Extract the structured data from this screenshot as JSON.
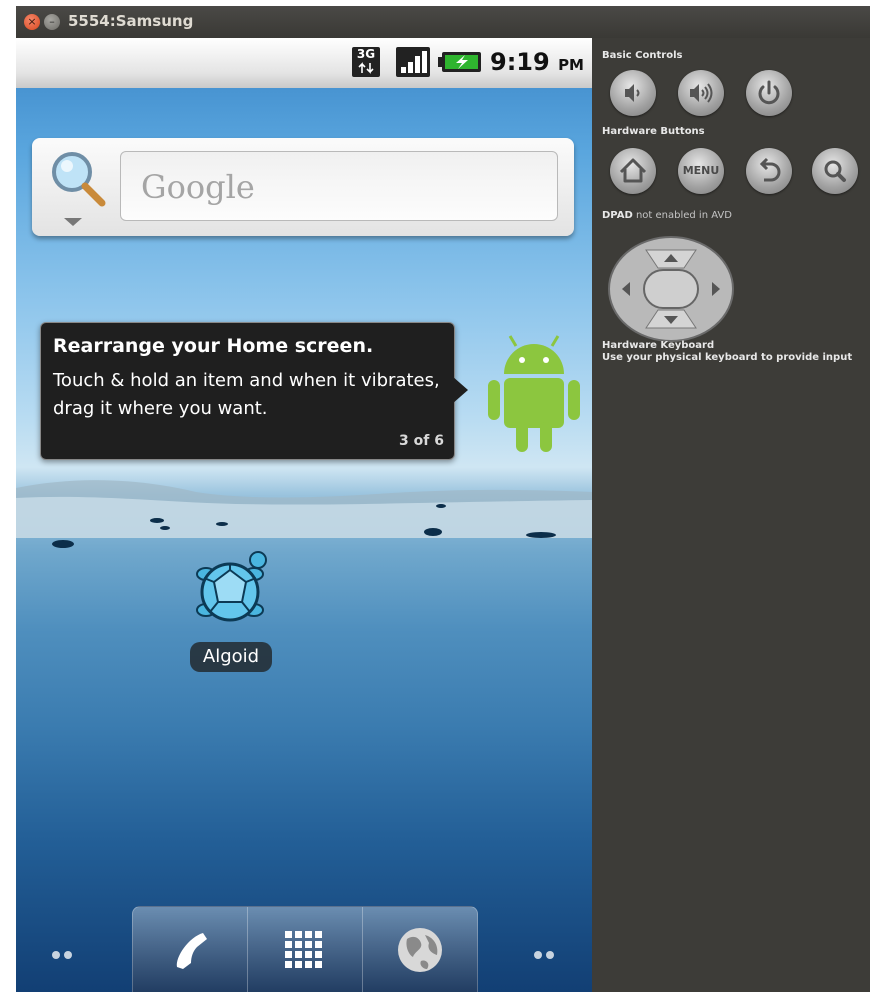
{
  "window": {
    "title": "5554:Samsung"
  },
  "status_bar": {
    "network": "3G",
    "time": "9:19",
    "ampm": "PM"
  },
  "search_widget": {
    "placeholder": "Google"
  },
  "tutorial": {
    "title": "Rearrange your Home screen.",
    "body": "Touch & hold an item and when it vibrates, drag it where you want.",
    "counter": "3 of 6"
  },
  "desktop": {
    "app_label": "Algoid"
  },
  "dock": {
    "items": [
      "phone-icon",
      "apps-grid-icon",
      "browser-globe-icon"
    ]
  },
  "panel": {
    "basic_controls_label": "Basic Controls",
    "hardware_buttons_label": "Hardware Buttons",
    "menu_button_label": "MENU",
    "dpad_label": "DPAD",
    "dpad_note": " not enabled in AVD",
    "keyboard_label": "Hardware Keyboard",
    "keyboard_note": "Use your physical keyboard to provide input"
  },
  "colors": {
    "title_bar": "#3c3b37",
    "close_button": "#d8461d",
    "panel_background": "#3d3c38",
    "android_green": "#8cc63f",
    "battery_green": "#2fb52f"
  }
}
